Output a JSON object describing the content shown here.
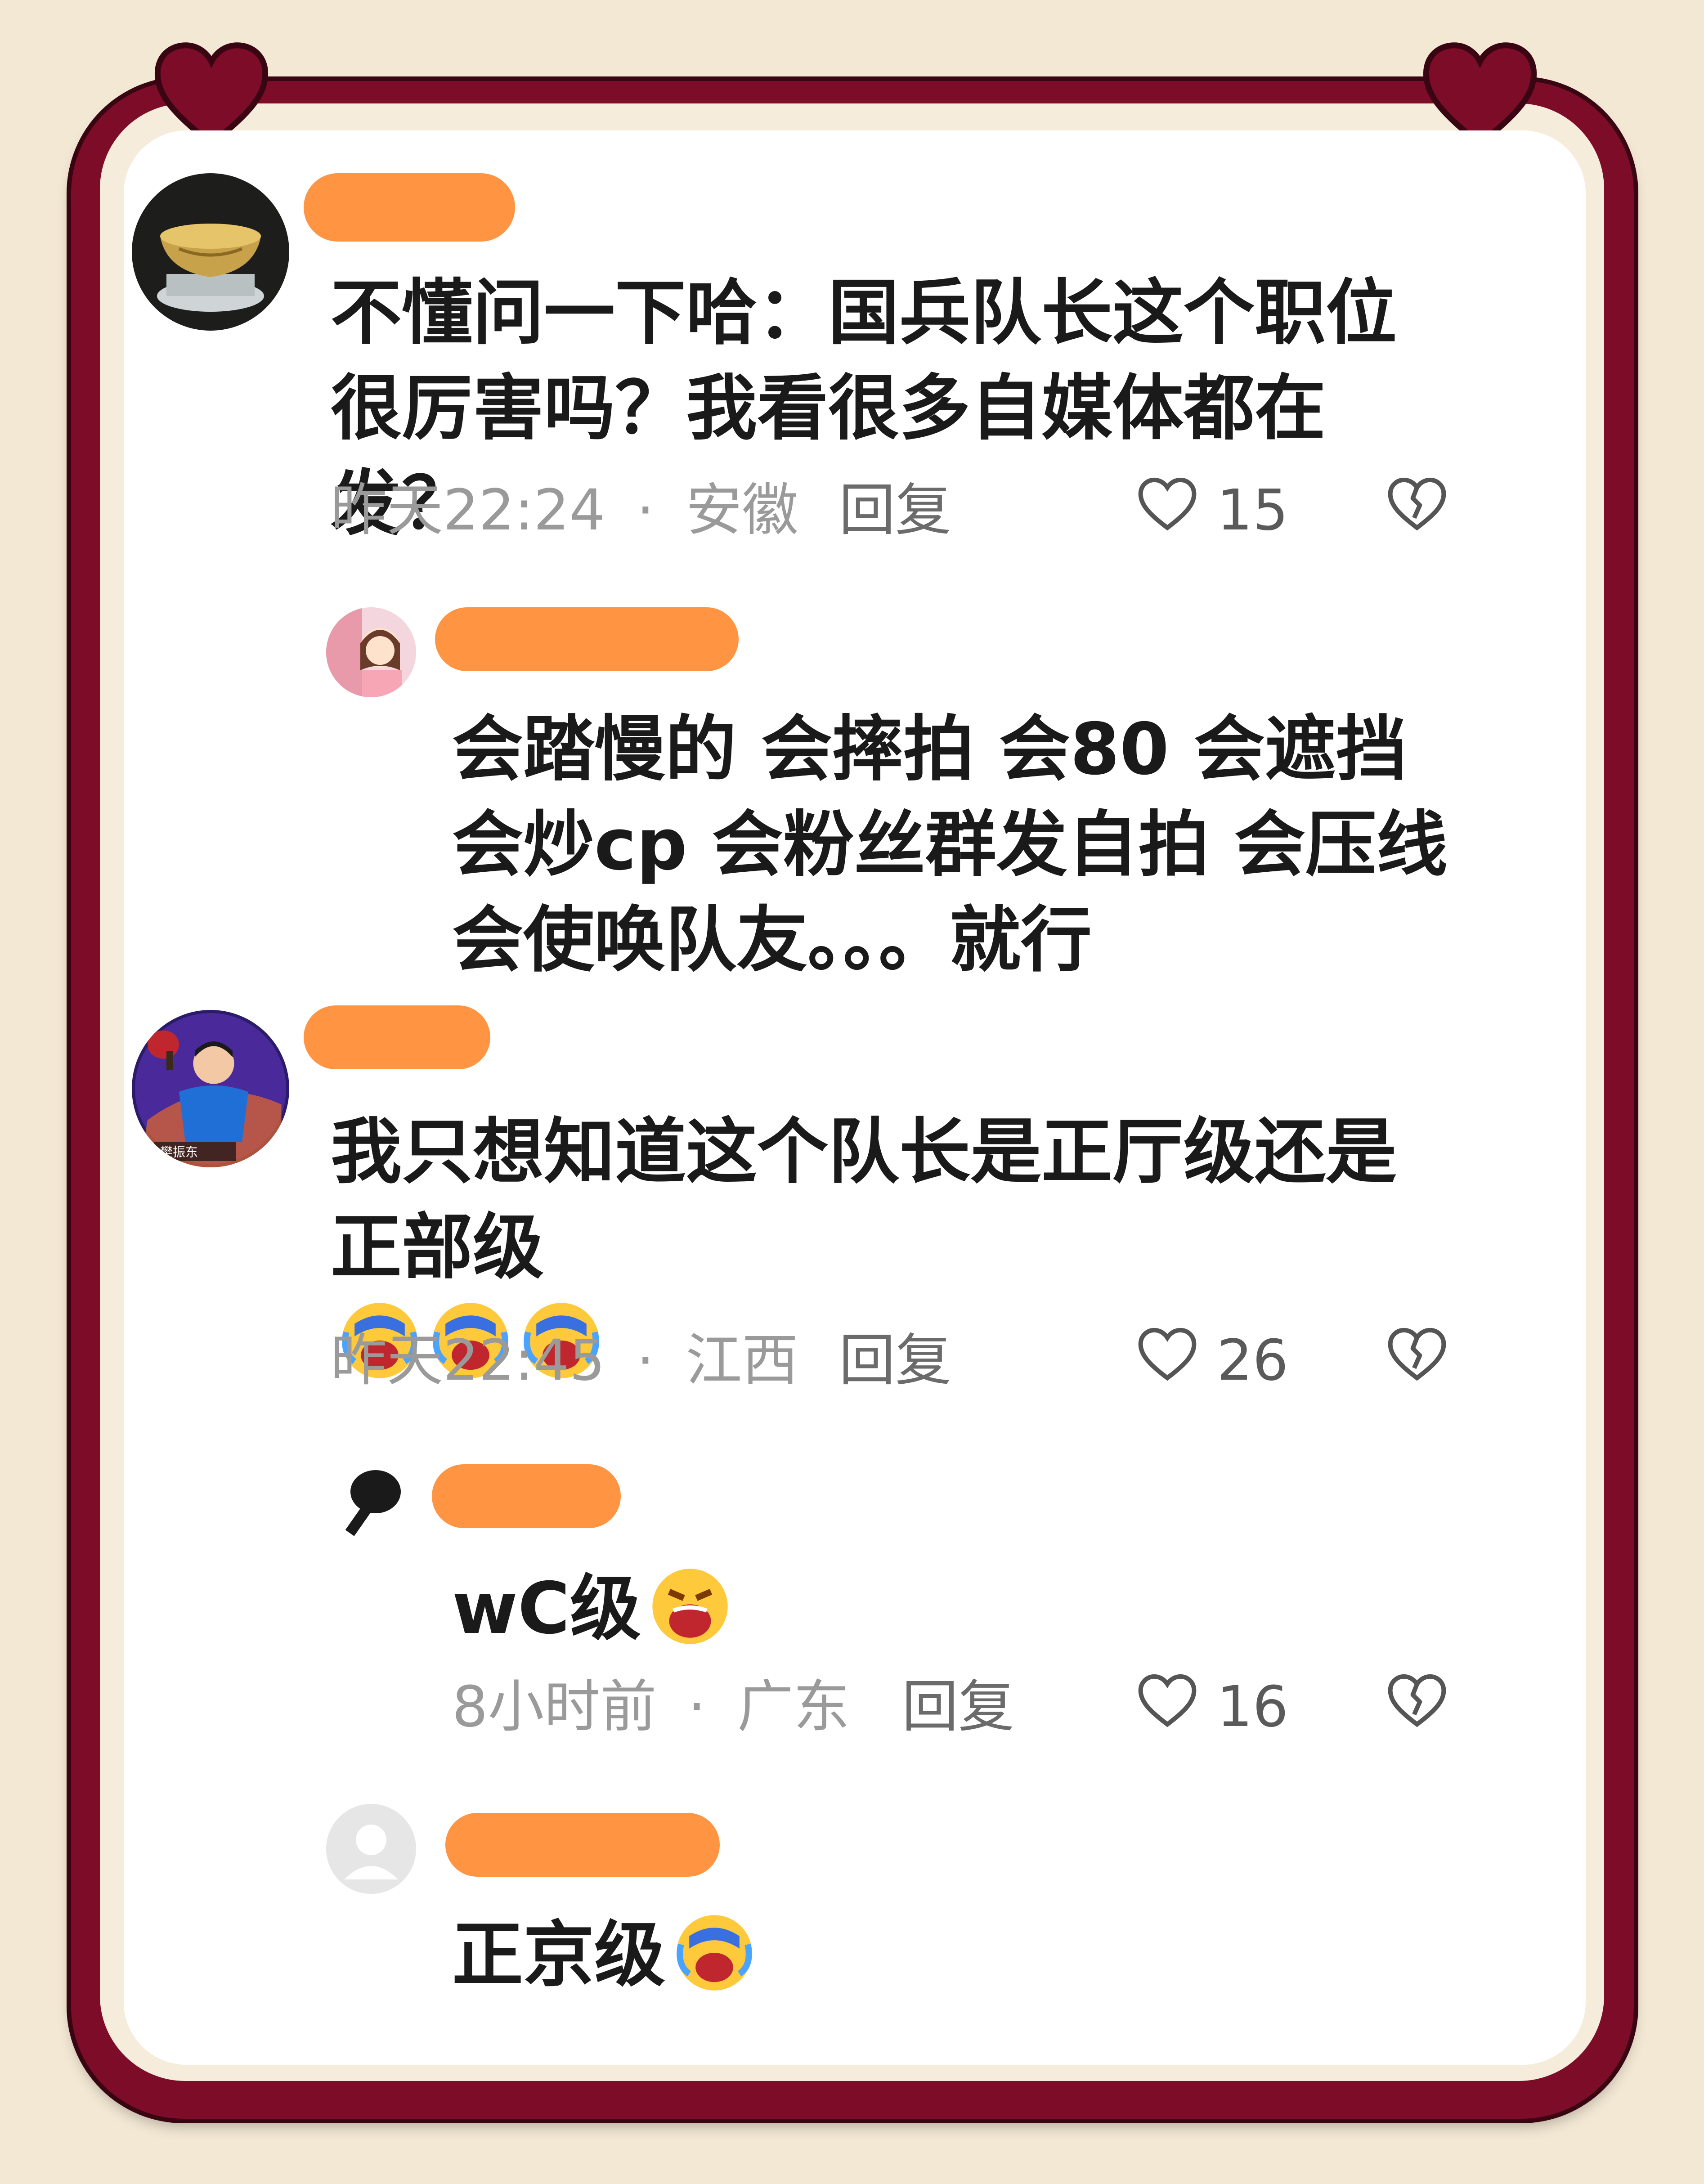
{
  "colors": {
    "frame": "#7d0c28",
    "name_bar": "#ff9442",
    "meta_text": "#9a9a9a",
    "body_text": "#1a1a1a"
  },
  "comments": [
    {
      "text": "不懂问一下哈：国兵队长这个职位很厉害吗？我看很多自媒体都在发？",
      "time": "昨天22:24",
      "separator": "·",
      "location": "安徽",
      "reply_label": "回复",
      "likes": "15",
      "avatar_icon": "golden-bowl-avatar"
    },
    {
      "text": "会踏慢的 会摔拍 会80 会遮挡 会炒cp 会粉丝群发自拍 会压线 会使唤队友。。。就行",
      "avatar_icon": "cartoon-girl-avatar"
    },
    {
      "text": "我只想知道这个队长是正厅级还是正部级",
      "emoji": [
        "laugh-cry-emoji",
        "laugh-cry-emoji",
        "laugh-cry-emoji"
      ],
      "avatar_text": "樊振东",
      "time": "昨天22:45",
      "separator": "·",
      "location": "江西",
      "reply_label": "回复",
      "likes": "26",
      "avatar_icon": "table-tennis-player-avatar"
    },
    {
      "text": "wC级",
      "emoji": [
        "screaming-cry-emoji"
      ],
      "time": "8小时前",
      "separator": "·",
      "location": "广东",
      "reply_label": "回复",
      "likes": "16",
      "avatar_icon": "paddle-avatar"
    },
    {
      "text": "正京级",
      "emoji": [
        "laugh-cry-emoji"
      ],
      "avatar_icon": "default-user-avatar"
    }
  ]
}
